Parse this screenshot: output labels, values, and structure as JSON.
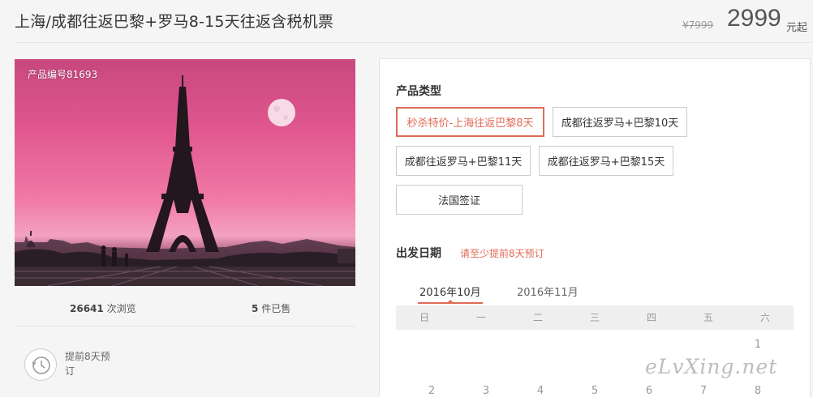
{
  "header": {
    "title": "上海/成都往返巴黎+罗马8-15天往返含税机票",
    "price_old": "¥7999",
    "price_now": "2999",
    "price_unit": "元起"
  },
  "photo": {
    "product_no": "产品编号81693"
  },
  "stats": {
    "views_value": "26641",
    "views_label": "次浏览",
    "sold_value": "5",
    "sold_label": "件已售"
  },
  "booking": {
    "advance_text": "提前8天预订"
  },
  "product_type": {
    "title": "产品类型",
    "options": [
      "秒杀特价-上海往返巴黎8天",
      "成都往返罗马+巴黎10天",
      "成都往返罗马+巴黎11天",
      "成都往返罗马+巴黎15天",
      "法国签证"
    ],
    "selected_index": 0
  },
  "departure": {
    "title": "出发日期",
    "hint": "请至少提前8天预订",
    "months": [
      "2016年10月",
      "2016年11月"
    ],
    "selected_month": 0,
    "weekdays": [
      "日",
      "一",
      "二",
      "三",
      "四",
      "五",
      "六"
    ],
    "days": [
      "1",
      "2",
      "3",
      "4",
      "5",
      "6",
      "7",
      "8"
    ]
  },
  "watermark": "eLvXing.net",
  "colors": {
    "accent": "#e06a56",
    "price": "#555555",
    "panel_bg": "#ffffff",
    "page_bg": "#f5f5f5"
  }
}
